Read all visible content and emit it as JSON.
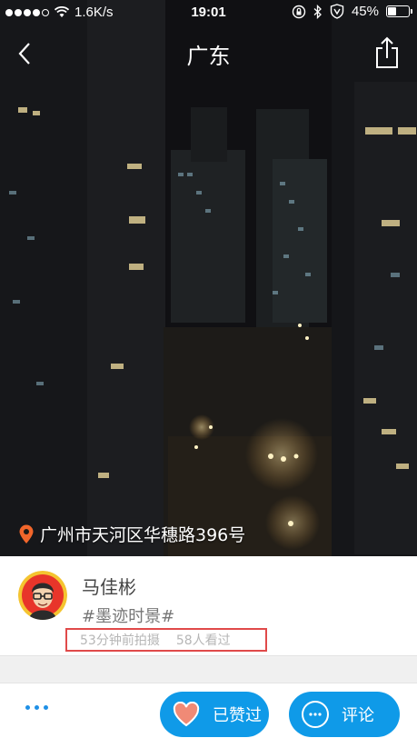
{
  "status_bar": {
    "network_speed": "1.6K/s",
    "time": "19:01",
    "battery_percent": "45%",
    "battery_level": 0.45,
    "signal_bars": 4
  },
  "nav": {
    "title": "广东",
    "back_icon": "chevron-left-icon",
    "share_icon": "share-icon"
  },
  "photo": {
    "location_icon": "map-pin-icon",
    "location_text": "广州市天河区华穗路396号"
  },
  "post": {
    "user_name": "马佳彬",
    "topic": "#墨迹时景#",
    "taken_ago": "53分钟前拍摄",
    "views": "58人看过"
  },
  "actions": {
    "more_icon": "more-dots-icon",
    "like_label": "已赞过",
    "like_icon": "heart-icon",
    "comment_label": "评论",
    "comment_icon": "comment-bubble-icon"
  },
  "colors": {
    "accent": "#0f9ae8",
    "highlight_box": "#e04a4a",
    "pin": "#f2662b",
    "heart": "#f08a76"
  }
}
